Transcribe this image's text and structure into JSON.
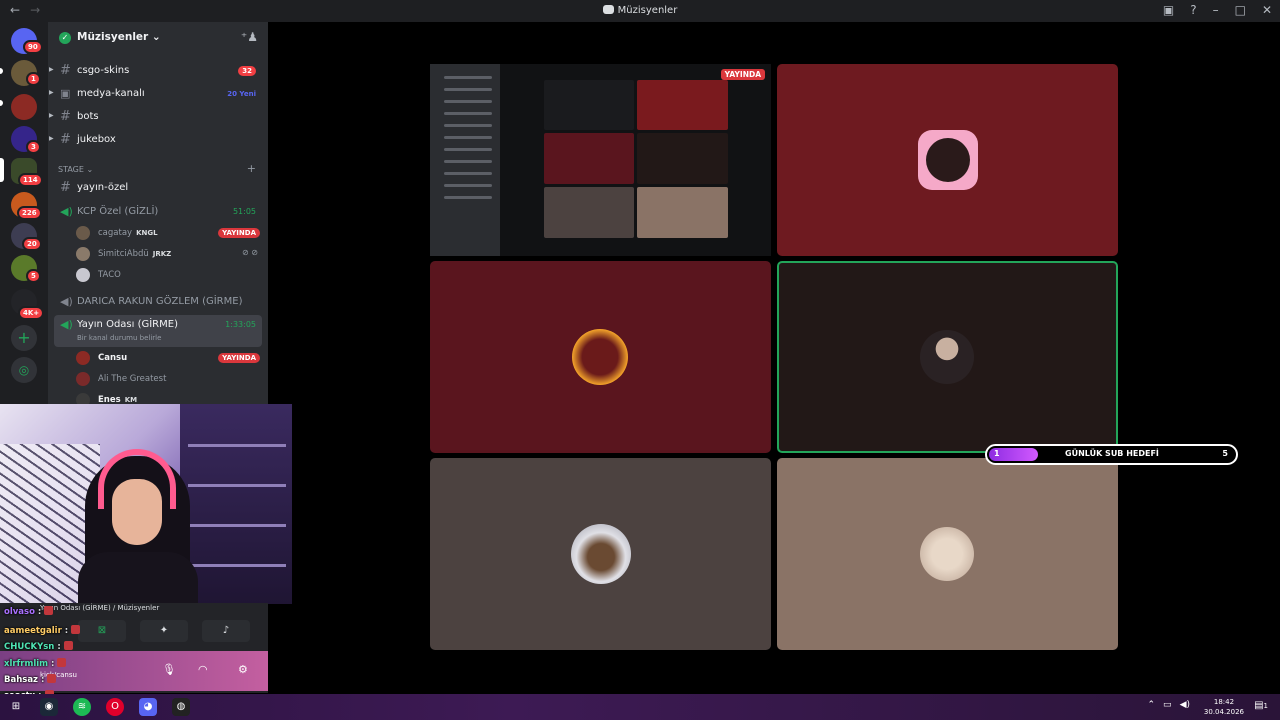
{
  "window": {
    "title": "Müzisyenler",
    "back_icon": "←",
    "forward_icon": "→"
  },
  "rail": {
    "badges": [
      "90",
      "1",
      "3",
      "114",
      "226",
      "20",
      "5",
      "4K+"
    ]
  },
  "server": {
    "name": "Müzisyenler ⌄"
  },
  "channels": [
    {
      "label": "csgo-skins",
      "count": "32"
    },
    {
      "label": "medya-kanalı",
      "new": "20 Yeni"
    },
    {
      "label": "bots"
    },
    {
      "label": "jukebox"
    }
  ],
  "stage": {
    "category": "STAGE ⌄",
    "channel": "yayın-özel"
  },
  "voice1": {
    "label": "KCP Özel (GİZLİ)",
    "time": "51:05",
    "users": [
      {
        "name": "cagatay",
        "tag": "KNGL",
        "live": "YAYINDA"
      },
      {
        "name": "SimitciAbdü",
        "tag": "JRKZ"
      },
      {
        "name": "TACO"
      }
    ]
  },
  "voice2": {
    "label": "DARICA RAKUN GÖZLEM (GİRME)"
  },
  "voice3": {
    "label": "Yayın Odası (GİRME)",
    "time": "1:33:05",
    "status": "Bir kanal durumu belirle",
    "users": [
      {
        "name": "Cansu",
        "live": "YAYINDA"
      },
      {
        "name": "Ali The Greatest"
      },
      {
        "name": "Enes",
        "tag": "KM"
      }
    ]
  },
  "voice_panel": {
    "room": "Yayın Odası (GİRME) / Müzisyenler"
  },
  "user_bar": {
    "info": "kick/cansu"
  },
  "chat": [
    {
      "user": "olvaso",
      "color": "#a970ff"
    },
    {
      "user": "aameetgalir",
      "color": "#ffcc66"
    },
    {
      "user": "CHUCKYsn",
      "color": "#4fe4b4"
    },
    {
      "user": "xlrfrmlim",
      "color": "#4fe4b4"
    },
    {
      "user": "Bahsaz",
      "color": "#ffffff"
    },
    {
      "user": "seactx",
      "color": "#ffffff"
    }
  ],
  "screen_share": {
    "live": "YAYINDA"
  },
  "sub_goal": {
    "current": "1",
    "label": "GÜNLÜK SUB HEDEFİ",
    "target": "5",
    "progress": 0.2
  },
  "taskbar": {
    "time": "18:42",
    "date": "30.04.2026",
    "notifications": "1"
  },
  "colors": {
    "tile_red": "#6e1a20",
    "tile_darkred": "#5a151e",
    "tile_dark": "#221817",
    "tile_gray": "#4c4240",
    "tile_tan": "#8a7366",
    "speaking": "#23a55a",
    "live": "#da373c"
  }
}
